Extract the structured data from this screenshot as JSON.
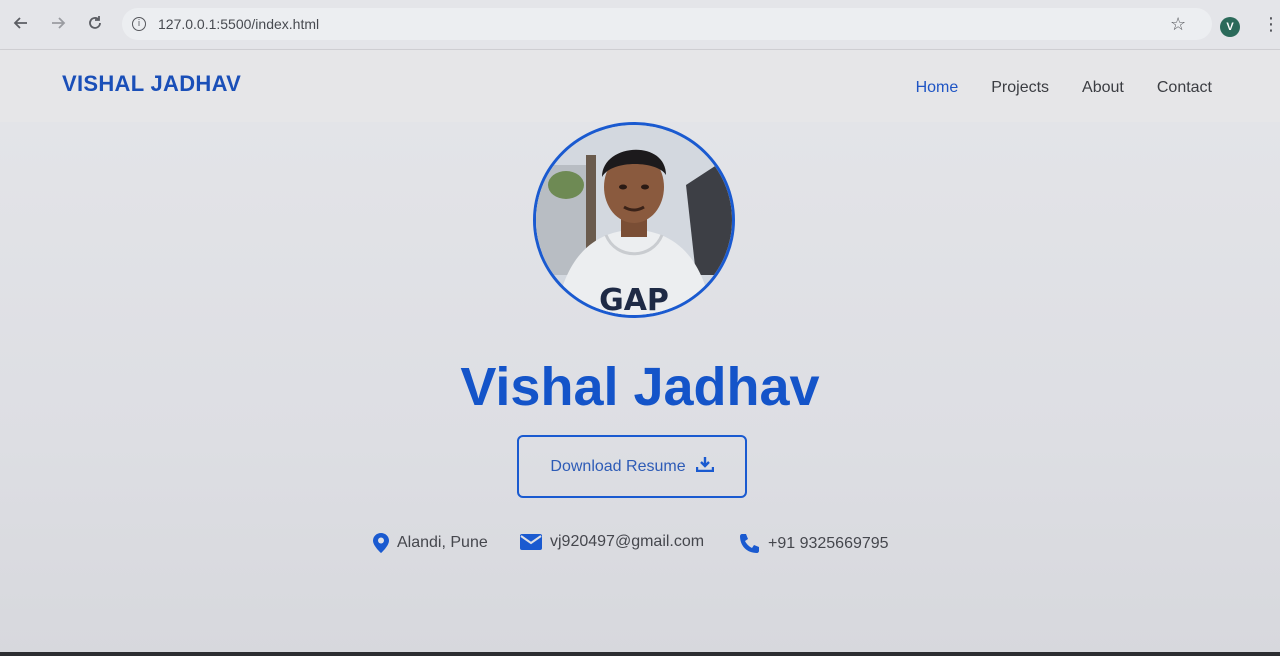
{
  "browser": {
    "url": "127.0.0.1:5500/index.html",
    "profile_initial": "V"
  },
  "header": {
    "brand": "VISHAL JADHAV",
    "nav": [
      {
        "label": "Home",
        "active": true
      },
      {
        "label": "Projects",
        "active": false
      },
      {
        "label": "About",
        "active": false
      },
      {
        "label": "Contact",
        "active": false
      }
    ]
  },
  "hero": {
    "name": "Vishal Jadhav",
    "resume_label": "Download Resume",
    "contacts": {
      "location": "Alandi, Pune",
      "email": "vj920497@gmail.com",
      "phone": "+91 9325669795"
    }
  },
  "colors": {
    "accent": "#1a5ad0",
    "brand": "#1a4fb8"
  }
}
